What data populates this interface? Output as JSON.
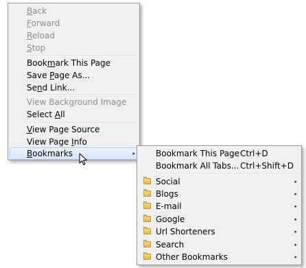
{
  "context_menu": {
    "items": [
      {
        "pre": "",
        "key": "B",
        "post": "ack",
        "disabled": true
      },
      {
        "pre": "",
        "key": "F",
        "post": "orward",
        "disabled": true
      },
      {
        "pre": "",
        "key": "R",
        "post": "eload",
        "disabled": true
      },
      {
        "pre": "",
        "key": "S",
        "post": "top",
        "disabled": true
      },
      {
        "pre": "Book",
        "key": "m",
        "post": "ark This Page",
        "disabled": false
      },
      {
        "pre": "Save ",
        "key": "P",
        "post": "age As...",
        "disabled": false
      },
      {
        "pre": "Se",
        "key": "n",
        "post": "d Link...",
        "disabled": false
      },
      {
        "pre": "View Back",
        "key": "g",
        "post": "round Image",
        "disabled": true
      },
      {
        "pre": "Select ",
        "key": "A",
        "post": "ll",
        "disabled": false
      },
      {
        "pre": "",
        "key": "V",
        "post": "iew Page Source",
        "disabled": false
      },
      {
        "pre": "View Page ",
        "key": "I",
        "post": "nfo",
        "disabled": false
      },
      {
        "pre": "",
        "key": "B",
        "post": "ookmarks",
        "disabled": false
      }
    ],
    "submenu_arrow": "▸"
  },
  "bookmarks_menu": {
    "commands": [
      {
        "label": "Bookmark This Page",
        "accel": "Ctrl+D"
      },
      {
        "label": "Bookmark All Tabs...",
        "accel": "Ctrl+Shift+D"
      }
    ],
    "folders": [
      {
        "label": "Social"
      },
      {
        "label": "Blogs"
      },
      {
        "label": "E-mail"
      },
      {
        "label": "Google"
      },
      {
        "label": "Url Shorteners"
      },
      {
        "label": "Search"
      },
      {
        "label": "Other Bookmarks"
      }
    ],
    "icon": "folder-icon"
  }
}
